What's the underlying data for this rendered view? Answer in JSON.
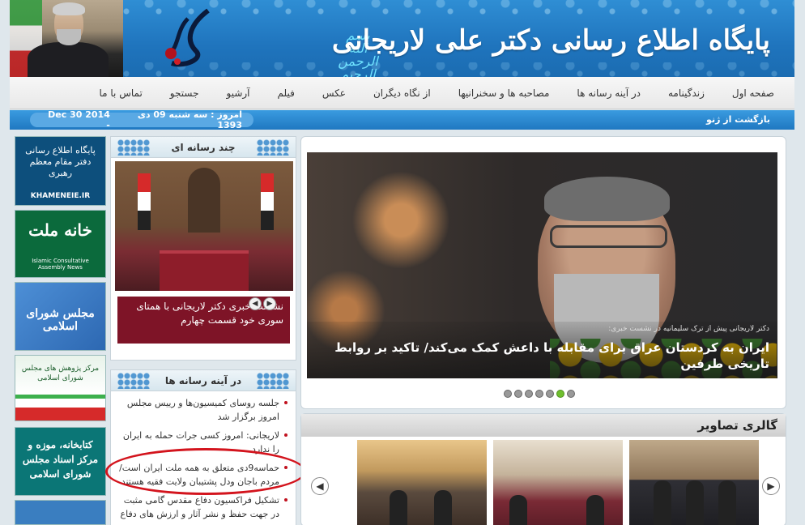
{
  "header": {
    "site_title": "پایگاه اطلاع رسانی دکتر علی لاریجانی",
    "bismillah": "بسم الله الرحمن الرحیم"
  },
  "nav": {
    "items": [
      "صفحه اول",
      "زندگینامه",
      "در آینه رسانه ها",
      "مصاحبه ها و سخنرانیها",
      "از نگاه دیگران",
      "عکس",
      "فیلم",
      "آرشیو",
      "جستجو",
      "تماس با ما"
    ]
  },
  "datebar": {
    "headline": "بازگشت از ژنو",
    "date_label": "امروز : سه شنبه 09 دی 1393",
    "gregorian": "2014 Dec 30 -"
  },
  "sidebar_banners": {
    "b1_text": "پایگاه اطلاع رسانی دفتر مقام معظم رهبری",
    "b1_sub": "KHAMENEIE.IR",
    "b2_text": "خانه ملت",
    "b2_sub": "Islamic Consultative Assembly News",
    "b3_text": "مجلس شورای اسلامی",
    "b4_text": "مرکز پژوهش های مجلس شورای اسلامی",
    "b5_text": "کتابخانه، موزه و مرکز اسناد مجلس شورای اسلامی"
  },
  "media_box": {
    "title": "چند رسانه ای",
    "caption": "نشست خبری دکتر لاریجانی با همتای سوری خود قسمت چهارم"
  },
  "mirror_box": {
    "title": "در آینه رسانه ها",
    "items": [
      "جلسه روسای کمیسیون‌ها و رییس مجلس امروز برگزار شد",
      "لاریجانی: امروز کسی جرات حمله به ایران را ندارد",
      "حماسه9دی متعلق به همه ملت ایران است/مردم باجان ودل پشتیبان ولایت فقیه هستند",
      "تشکیل فراکسیون دفاع مقدس گامی مثبت در جهت حفظ و نشر آثار و ارزش های دفاع"
    ]
  },
  "slider": {
    "kicker": "دکتر لاریجانی پیش از ترک سلیمانیه در نشست خبری:",
    "title": "ایران به کردستان عراق برای مقابله با داعش کمک می‌کند/ تاکید بر روابط تاریخی طرفین",
    "dot_count": 7,
    "active_dot": 5
  },
  "gallery": {
    "title": "گالری تصاویر"
  },
  "colors": {
    "header_blue": "#1f74bd",
    "caption_maroon": "#7e1427",
    "bullet_red": "#c1121f",
    "active_dot_green": "#6fbf2e",
    "annotation_red": "#d3141d"
  }
}
